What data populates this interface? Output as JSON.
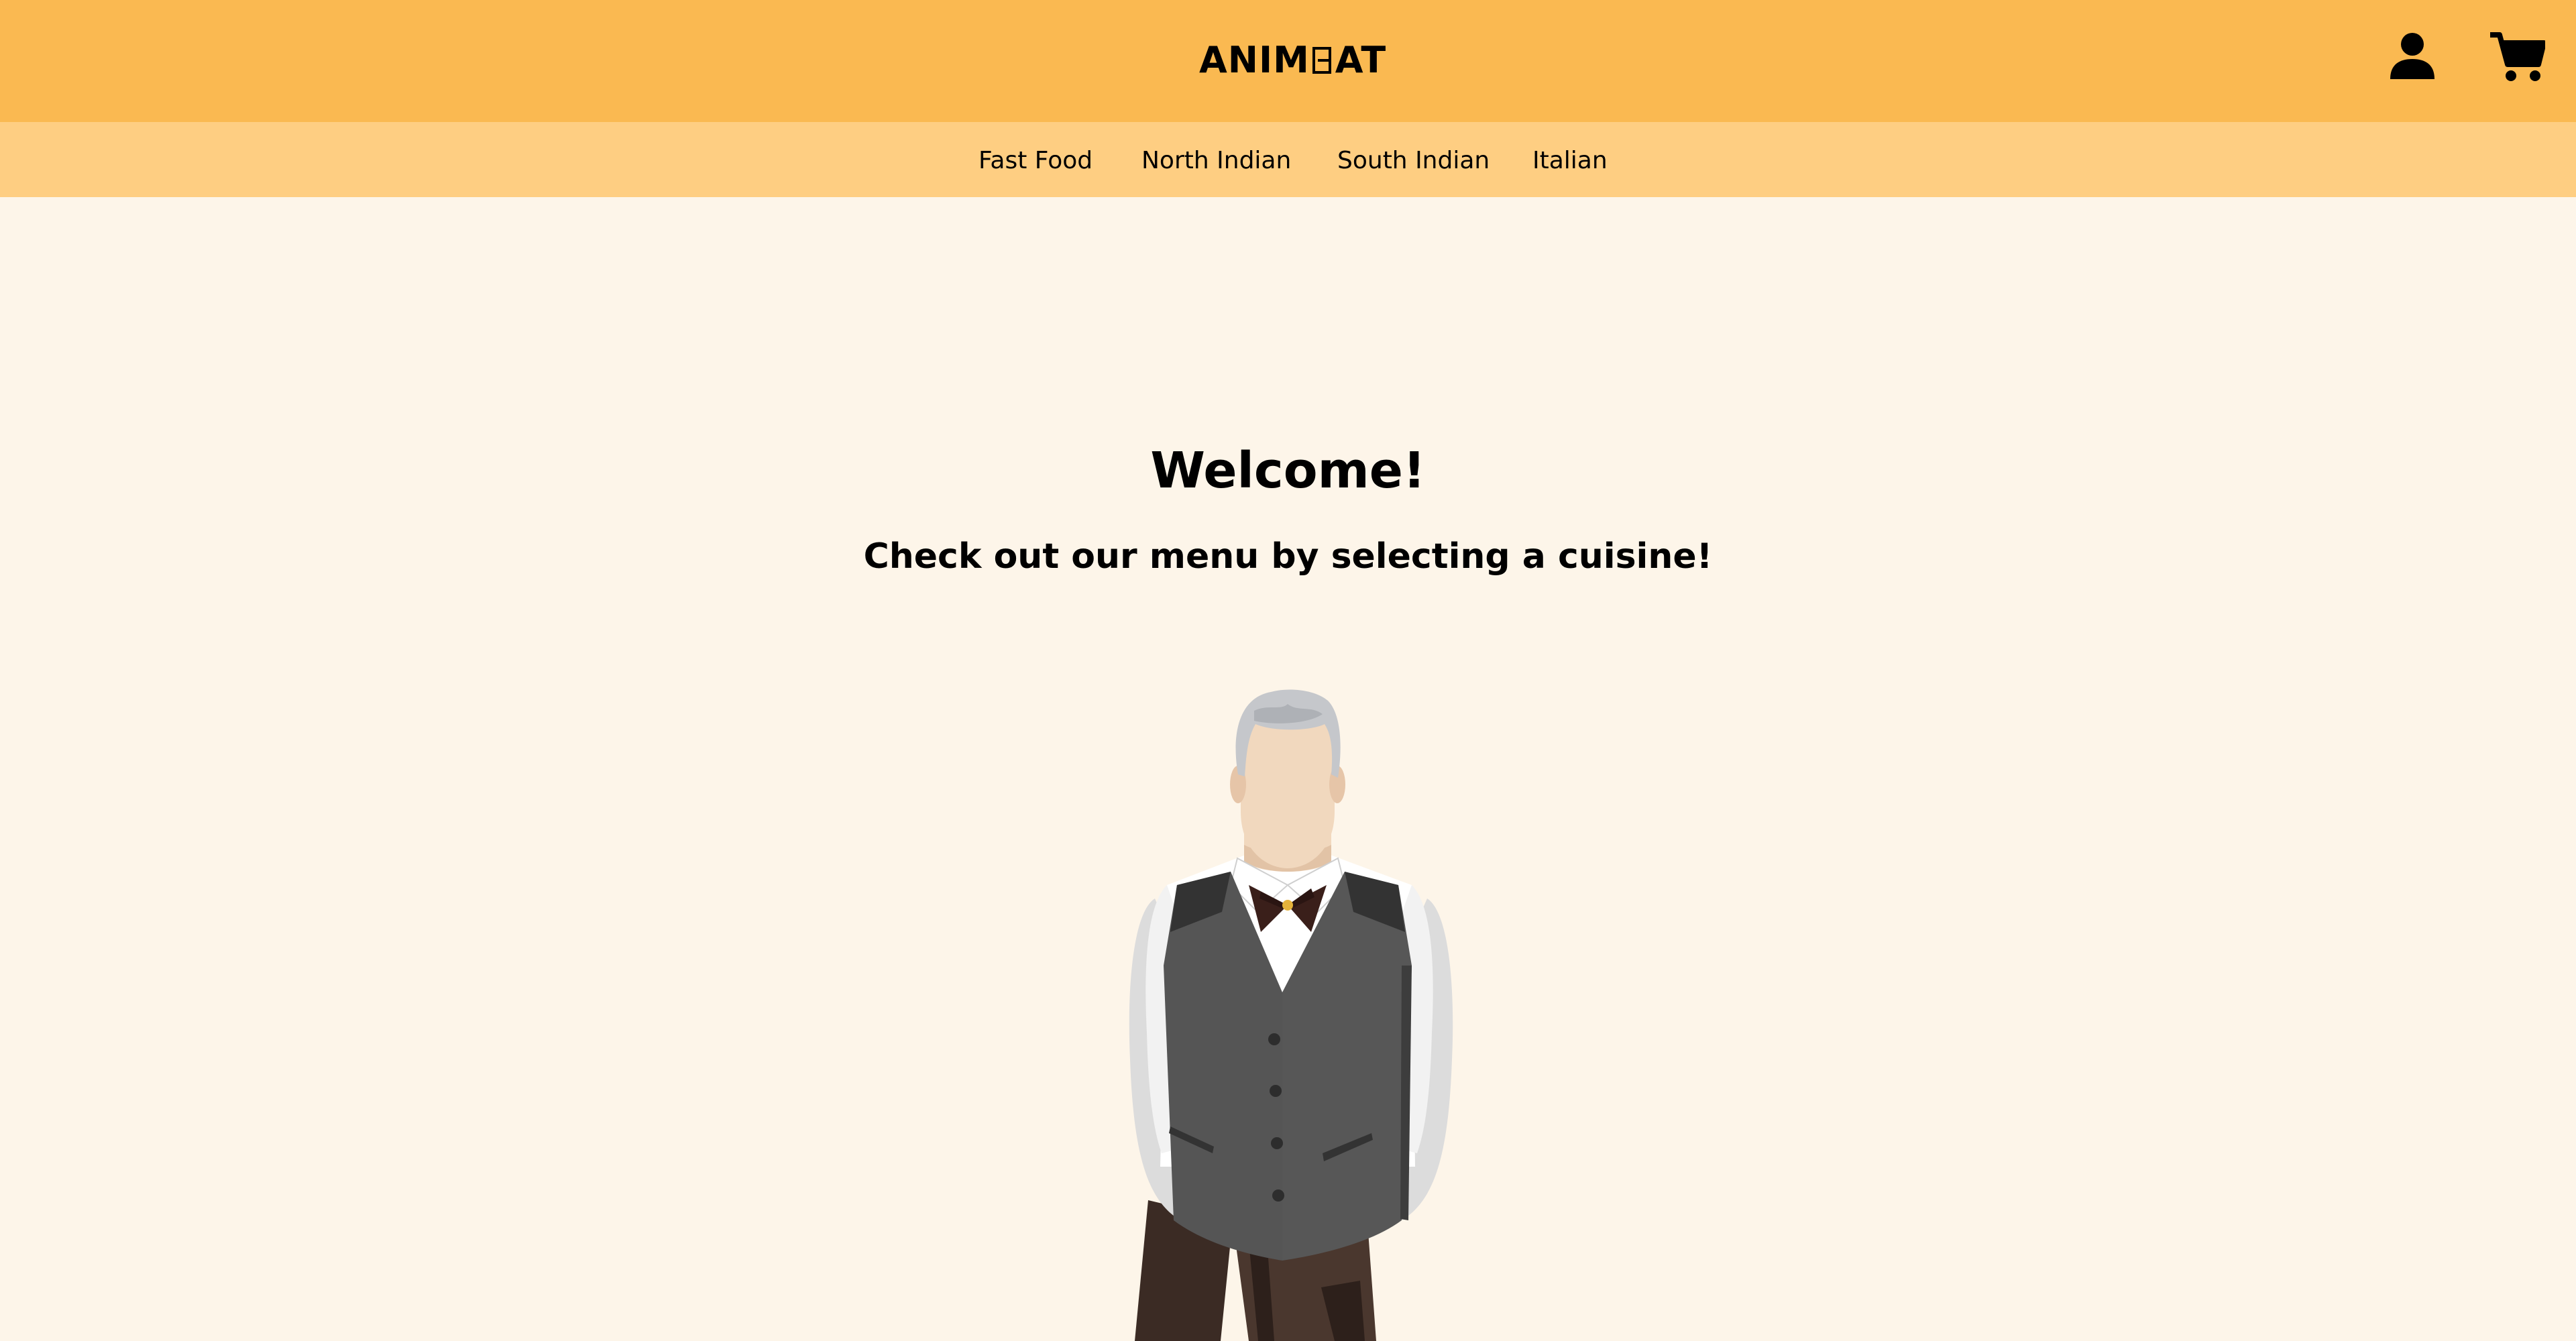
{
  "header": {
    "logo": {
      "part1": "ANIM",
      "part2": "E",
      "part3": "AT"
    },
    "icons": {
      "account": "user-icon",
      "cart": "cart-icon"
    },
    "colors": {
      "topbar": "#fab951",
      "navbar": "#fece82",
      "background": "#fdf5e9"
    }
  },
  "nav": {
    "items": [
      {
        "label": "Fast Food"
      },
      {
        "label": "North Indian"
      },
      {
        "label": "South Indian"
      },
      {
        "label": "Italian"
      }
    ]
  },
  "hero": {
    "title": "Welcome!",
    "subtitle": "Check out our menu by selecting a cuisine!"
  }
}
